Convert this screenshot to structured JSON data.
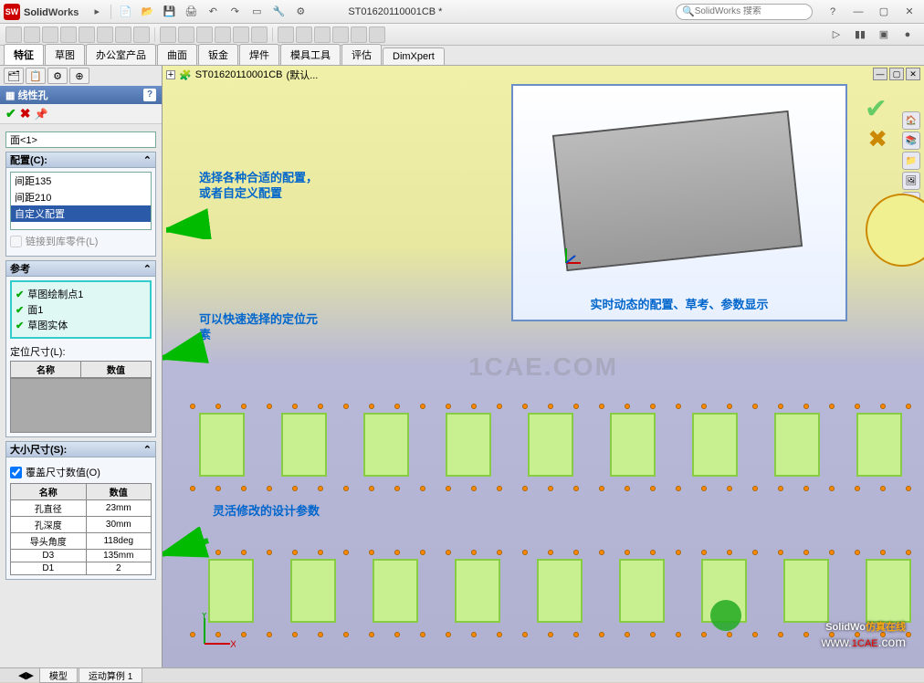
{
  "app": {
    "brand_left": "Solid",
    "brand_right": "Works"
  },
  "titlebar": {
    "doc_title": "ST01620110001CB *",
    "search_placeholder": "SolidWorks 搜索"
  },
  "tabs": [
    "特征",
    "草图",
    "办公室产品",
    "曲面",
    "钣金",
    "焊件",
    "模具工具",
    "评估",
    "DimXpert"
  ],
  "crumb": {
    "doc": "ST01620110001CB",
    "config": "(默认..."
  },
  "pm": {
    "title": "线性孔",
    "face_field": "面<1>",
    "sections": {
      "config": {
        "header": "配置(C):",
        "items": [
          "间距135",
          "间距210",
          "自定义配置"
        ],
        "selected_idx": 2,
        "link_checkbox": "链接到库零件(L)"
      },
      "ref": {
        "header": "参考",
        "items": [
          "草图绘制点1",
          "面1",
          "草图实体"
        ],
        "locate_label": "定位尺寸(L):",
        "table_headers": [
          "名称",
          "数值"
        ]
      },
      "size": {
        "header": "大小尺寸(S):",
        "override_label": "覆盖尺寸数值(O)",
        "headers": [
          "名称",
          "数值"
        ],
        "rows": [
          {
            "name": "孔直径",
            "value": "23mm"
          },
          {
            "name": "孔深度",
            "value": "30mm"
          },
          {
            "name": "导头角度",
            "value": "118deg"
          },
          {
            "name": "D3",
            "value": "135mm"
          },
          {
            "name": "D1",
            "value": "2"
          }
        ]
      }
    }
  },
  "annotations": {
    "a1": "选择各种合适的配置，或者自定义配置",
    "a2": "可以快速选择的定位元素",
    "a3": "灵活修改的设计参数",
    "preview_caption": "实时动态的配置、草考、参数显示"
  },
  "bottom_tabs": [
    "模型",
    "运动算例 1"
  ],
  "watermark": {
    "site_cn": "仿真在线",
    "site_url": "www.1CAE.com",
    "brand_overlay": "SolidWo",
    "center": "1CAE.COM"
  }
}
